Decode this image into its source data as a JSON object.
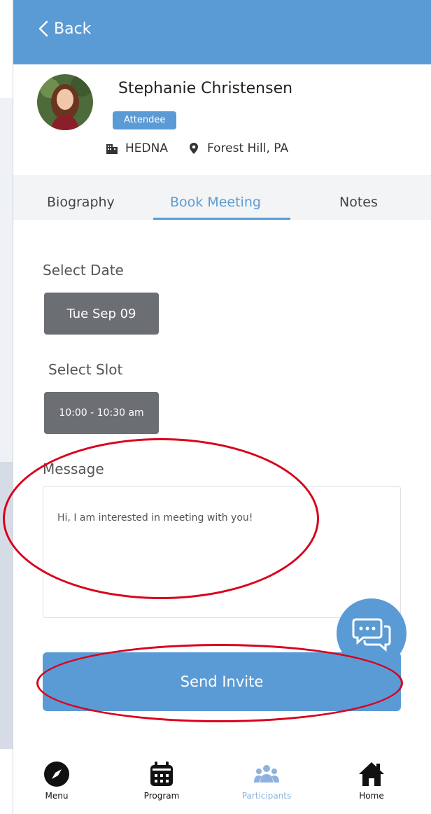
{
  "header": {
    "back_label": "Back"
  },
  "profile": {
    "name": "Stephanie Christensen",
    "badge": "Attendee",
    "organization": "HEDNA",
    "location": "Forest Hill, PA"
  },
  "tabs": [
    {
      "label": "Biography"
    },
    {
      "label": "Book Meeting",
      "active": true
    },
    {
      "label": "Notes"
    }
  ],
  "booking": {
    "date_label": "Select Date",
    "date_value": "Tue Sep 09",
    "slot_label": "Select Slot",
    "slot_value": "10:00 - 10:30 am",
    "message_label": "Message",
    "message_value": "Hi, I am interested in meeting with you!",
    "send_label": "Send Invite"
  },
  "bottom_nav": [
    {
      "label": "Menu",
      "icon": "compass-icon"
    },
    {
      "label": "Program",
      "icon": "calendar-icon"
    },
    {
      "label": "Participants",
      "icon": "people-icon",
      "active": true
    },
    {
      "label": "Home",
      "icon": "home-icon"
    }
  ],
  "colors": {
    "accent": "#5b9bd5",
    "chip": "#6b6e72",
    "annotation": "#d9001b"
  }
}
